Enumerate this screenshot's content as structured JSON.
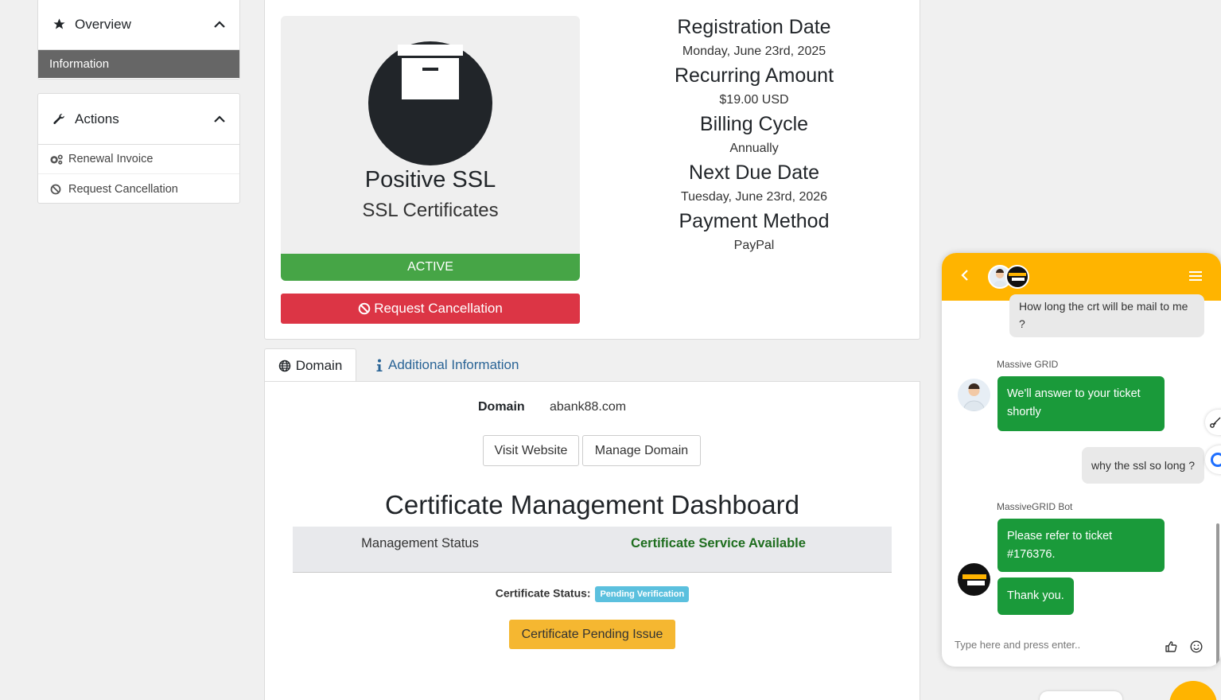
{
  "sidebar": {
    "overview": {
      "title": "Overview",
      "items": [
        {
          "label": "Information"
        }
      ]
    },
    "actions": {
      "title": "Actions",
      "items": [
        {
          "label": "Renewal Invoice"
        },
        {
          "label": "Request Cancellation"
        }
      ]
    }
  },
  "product": {
    "name": "Positive SSL",
    "group": "SSL Certificates",
    "status": "ACTIVE",
    "cancel_label": "Request Cancellation"
  },
  "details": [
    {
      "label": "Registration Date",
      "value": "Monday, June 23rd, 2025"
    },
    {
      "label": "Recurring Amount",
      "value": "$19.00 USD"
    },
    {
      "label": "Billing Cycle",
      "value": "Annually"
    },
    {
      "label": "Next Due Date",
      "value": "Tuesday, June 23rd, 2026"
    },
    {
      "label": "Payment Method",
      "value": "PayPal"
    }
  ],
  "tabs": [
    {
      "label": "Domain"
    },
    {
      "label": "Additional Information"
    }
  ],
  "domain": {
    "label": "Domain",
    "value": "abank88.com",
    "visit_label": "Visit Website",
    "manage_label": "Manage Domain"
  },
  "dashboard": {
    "title": "Certificate Management Dashboard",
    "status_label": "Management Status",
    "status_value": "Certificate Service Available",
    "cert_status_label": "Certificate Status:",
    "cert_status_badge": "Pending Verification",
    "pending_button": "Certificate Pending Issue"
  },
  "chat": {
    "messages": {
      "user1": "How long the crt will be mail to me ?",
      "sender1": "Massive GRID",
      "bot1": "We'll answer to your ticket shortly",
      "user2": "why the ssl so long ?",
      "sender2": "MassiveGRID Bot",
      "bot2": "Please refer to ticket #176376.",
      "bot3": "Thank you."
    },
    "input_placeholder": "Type here and press enter..",
    "accent": "#ffb400",
    "bot_bubble": "#1a9a3a"
  },
  "colors": {
    "active": "#46a546",
    "danger": "#dc3545",
    "badge": "#5bc0de",
    "warning": "#f5b731"
  }
}
